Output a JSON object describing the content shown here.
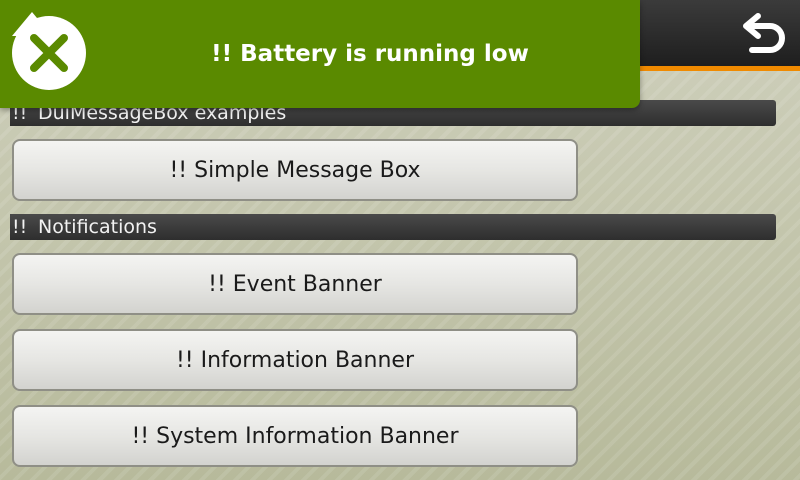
{
  "banner": {
    "text": "!! Battery is running low",
    "icon": "battery-low-icon",
    "color": "#5a8a00"
  },
  "navbar": {
    "accent_color": "#f08a00",
    "back_icon": "back-arrow-icon"
  },
  "sections": [
    {
      "bang": "!!",
      "label": "DuiMessageBox examples"
    },
    {
      "bang": "!!",
      "label": "Notifications"
    }
  ],
  "buttons": [
    {
      "label": "!! Simple Message Box"
    },
    {
      "label": "!! Event Banner"
    },
    {
      "label": "!! Information Banner"
    },
    {
      "label": "!! System Information Banner"
    }
  ]
}
